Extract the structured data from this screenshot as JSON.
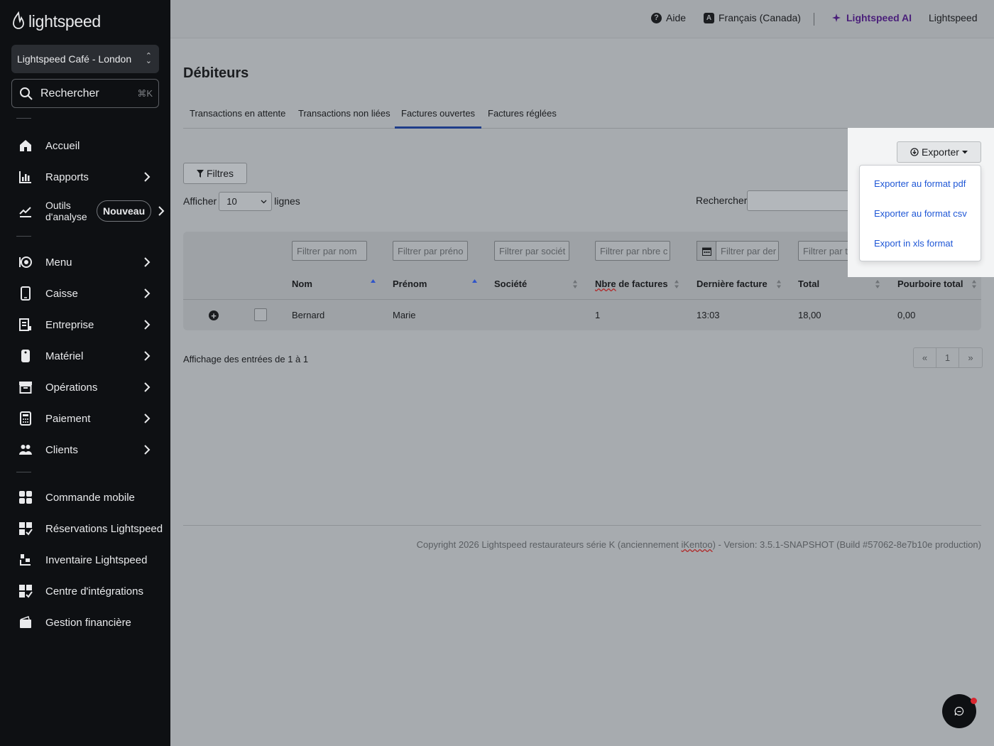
{
  "sidebar": {
    "logo_text": "lightspeed",
    "store_name": "Lightspeed Café - London",
    "search": {
      "label": "Rechercher",
      "shortcut": "⌘K"
    },
    "items": [
      {
        "label": "Accueil",
        "icon": "home-icon"
      },
      {
        "label": "Rapports",
        "icon": "bar-chart-icon"
      },
      {
        "label": "Outils d'analyse",
        "line1": "Outils",
        "line2": "d'analyse",
        "badge": "Nouveau",
        "icon": "analytics-icon"
      },
      {
        "label": "Menu",
        "icon": "menu-icon"
      },
      {
        "label": "Caisse",
        "icon": "tablet-icon"
      },
      {
        "label": "Entreprise",
        "icon": "business-icon"
      },
      {
        "label": "Matériel",
        "icon": "device-icon"
      },
      {
        "label": "Opérations",
        "icon": "archive-icon"
      },
      {
        "label": "Paiement",
        "icon": "calculator-icon"
      },
      {
        "label": "Clients",
        "icon": "users-icon"
      },
      {
        "label": "Commande mobile",
        "icon": "mobile-order-icon"
      },
      {
        "label": "Réservations Lightspeed",
        "icon": "reservations-icon"
      },
      {
        "label": "Inventaire Lightspeed",
        "icon": "inventory-icon"
      },
      {
        "label": "Centre d'intégrations",
        "icon": "integrations-icon"
      },
      {
        "label": "Gestion financière",
        "icon": "wallet-icon"
      }
    ]
  },
  "topbar": {
    "help": "Aide",
    "language": "Français (Canada)",
    "ai": "Lightspeed AI",
    "account": "Lightspeed"
  },
  "page": {
    "title": "Débiteurs",
    "tabs": [
      "Transactions en attente",
      "Transactions non liées",
      "Factures ouvertes",
      "Factures réglées"
    ],
    "active_tab": "Factures ouvertes",
    "filters_button": "Filtres",
    "show_prefix": "Afficher",
    "show_value": "10",
    "show_suffix": "lignes",
    "search_label": "Rechercher:",
    "export": {
      "button": "Exporter",
      "options": [
        "Exporter au format pdf",
        "Exporter au format csv",
        "Export in xls format"
      ]
    }
  },
  "table": {
    "filter_placeholders": {
      "nom": "Filtrer par nom",
      "prenom": "Filtrer par préno",
      "societe": "Filtrer par sociét",
      "nbre": "Filtrer par nbre c",
      "derniere": "Filtrer par der",
      "total": "Filtrer par tota"
    },
    "headers": {
      "nom": "Nom",
      "prenom": "Prénom",
      "societe": "Société",
      "nbre_a": "Nbre",
      "nbre_b": " de factures",
      "derniere": "Dernière facture",
      "total": "Total",
      "pourboire": "Pourboire total"
    },
    "rows": [
      {
        "nom": "Bernard",
        "prenom": "Marie",
        "societe": "",
        "nbre": "1",
        "derniere": "13:03",
        "total": "18,00",
        "pourboire": "0,00"
      }
    ]
  },
  "pagination": {
    "info": "Affichage des entrées de 1 à 1",
    "prev": "«",
    "page": "1",
    "next": "»"
  },
  "footer": {
    "part1": "Copyright 2026 Lightspeed restaurateurs série K (anciennement ",
    "brand": "iKentoo",
    "part2": ") - Version: 3.5.1-SNAPSHOT (Build #57062-8e7b10e production)"
  },
  "colors": {
    "sidebar_bg": "#0e1013",
    "link_blue": "#1f57d6",
    "ai_purple": "#4a1f7a",
    "tab_active": "#1f3d8a",
    "notification": "#d8262f"
  }
}
